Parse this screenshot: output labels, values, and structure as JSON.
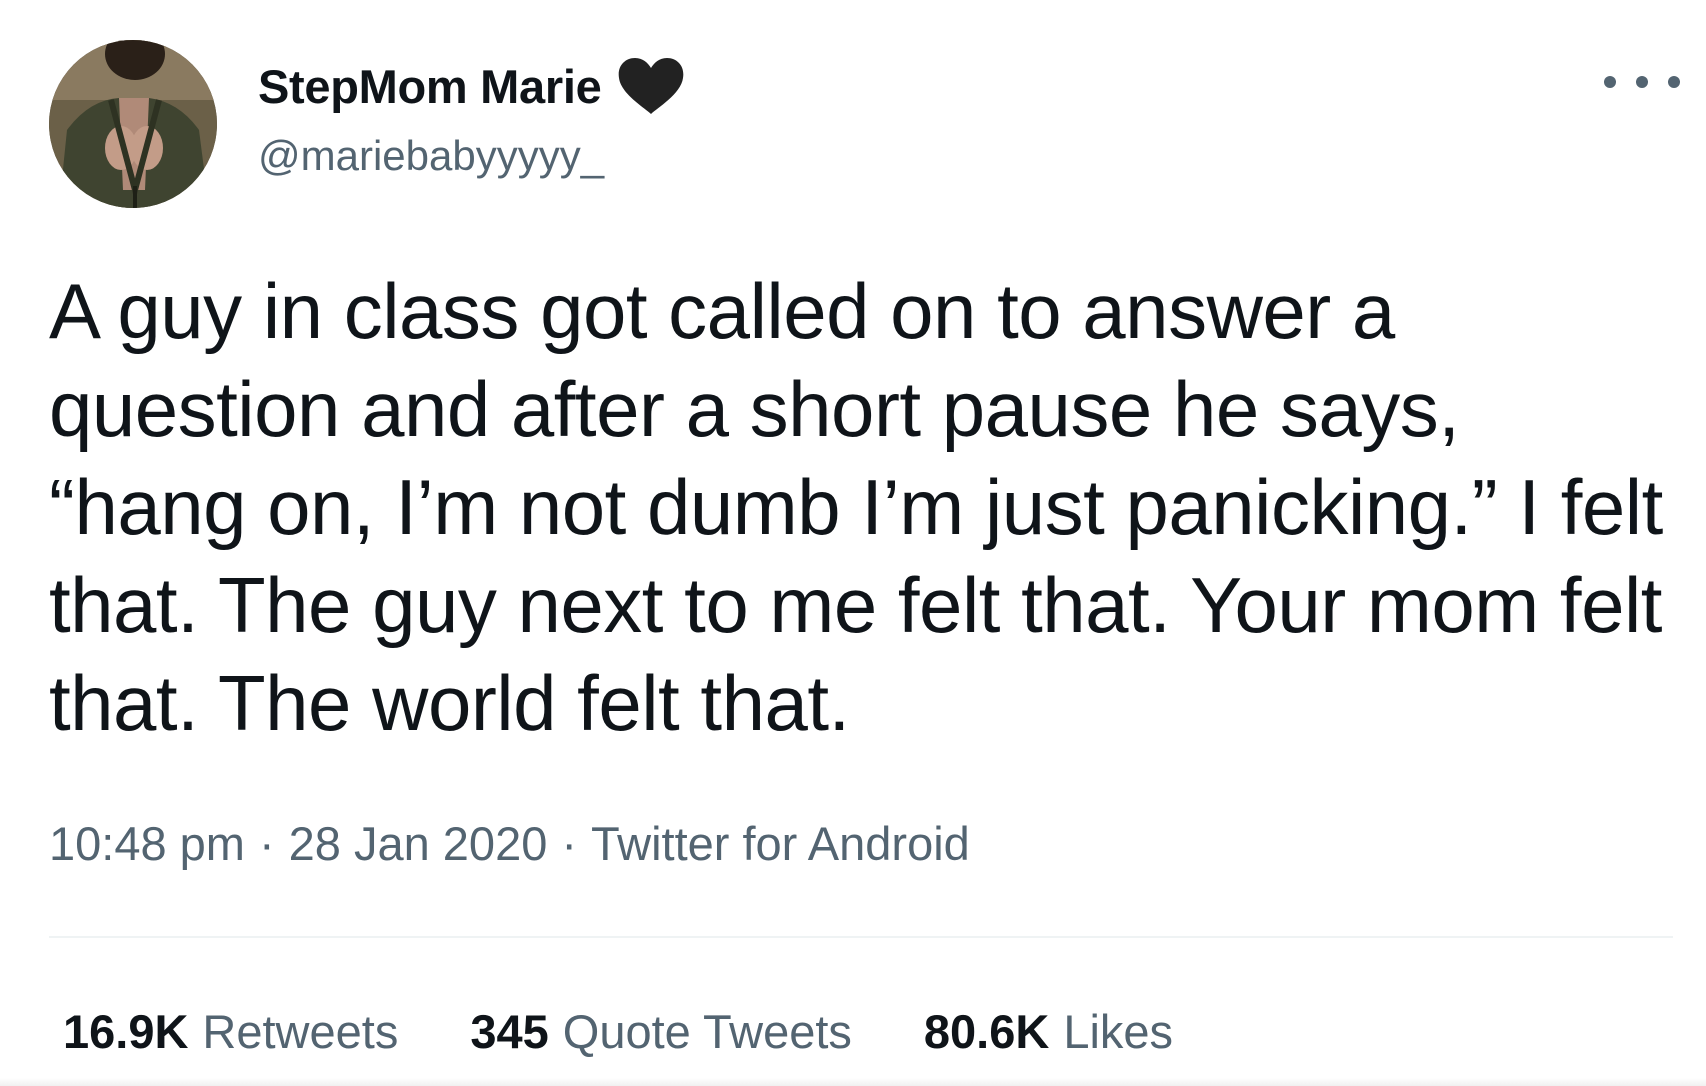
{
  "author": {
    "display_name": "StepMom Marie",
    "handle": "@mariebabyyyyy_",
    "badge_icon": "black-heart-icon",
    "avatar_icon": "profile-photo"
  },
  "tweet": {
    "text": "A guy in class got called on to answer a question and after a short pause he says, “hang on, I’m not dumb I’m just panicking.” I felt that. The guy next to me felt that. Your mom felt that. The world felt that.",
    "time": "10:48 pm",
    "date": "28 Jan 2020",
    "source": "Twitter for Android",
    "separator": "·"
  },
  "stats": {
    "retweets_count": "16.9K",
    "retweets_label": "Retweets",
    "quotes_count": "345",
    "quotes_label": "Quote Tweets",
    "likes_count": "80.6K",
    "likes_label": "Likes"
  },
  "colors": {
    "primary_text": "#0f1419",
    "secondary_text": "#536471",
    "divider": "#eff3f4",
    "heart": "#222222"
  }
}
